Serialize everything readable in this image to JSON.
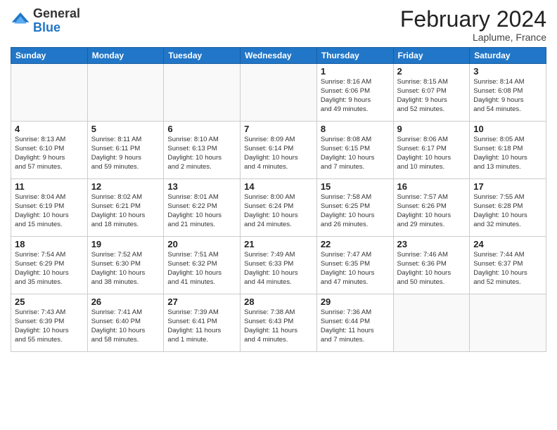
{
  "header": {
    "logo_general": "General",
    "logo_blue": "Blue",
    "month_title": "February 2024",
    "location": "Laplume, France"
  },
  "days_of_week": [
    "Sunday",
    "Monday",
    "Tuesday",
    "Wednesday",
    "Thursday",
    "Friday",
    "Saturday"
  ],
  "weeks": [
    [
      {
        "num": "",
        "info": ""
      },
      {
        "num": "",
        "info": ""
      },
      {
        "num": "",
        "info": ""
      },
      {
        "num": "",
        "info": ""
      },
      {
        "num": "1",
        "info": "Sunrise: 8:16 AM\nSunset: 6:06 PM\nDaylight: 9 hours\nand 49 minutes."
      },
      {
        "num": "2",
        "info": "Sunrise: 8:15 AM\nSunset: 6:07 PM\nDaylight: 9 hours\nand 52 minutes."
      },
      {
        "num": "3",
        "info": "Sunrise: 8:14 AM\nSunset: 6:08 PM\nDaylight: 9 hours\nand 54 minutes."
      }
    ],
    [
      {
        "num": "4",
        "info": "Sunrise: 8:13 AM\nSunset: 6:10 PM\nDaylight: 9 hours\nand 57 minutes."
      },
      {
        "num": "5",
        "info": "Sunrise: 8:11 AM\nSunset: 6:11 PM\nDaylight: 9 hours\nand 59 minutes."
      },
      {
        "num": "6",
        "info": "Sunrise: 8:10 AM\nSunset: 6:13 PM\nDaylight: 10 hours\nand 2 minutes."
      },
      {
        "num": "7",
        "info": "Sunrise: 8:09 AM\nSunset: 6:14 PM\nDaylight: 10 hours\nand 4 minutes."
      },
      {
        "num": "8",
        "info": "Sunrise: 8:08 AM\nSunset: 6:15 PM\nDaylight: 10 hours\nand 7 minutes."
      },
      {
        "num": "9",
        "info": "Sunrise: 8:06 AM\nSunset: 6:17 PM\nDaylight: 10 hours\nand 10 minutes."
      },
      {
        "num": "10",
        "info": "Sunrise: 8:05 AM\nSunset: 6:18 PM\nDaylight: 10 hours\nand 13 minutes."
      }
    ],
    [
      {
        "num": "11",
        "info": "Sunrise: 8:04 AM\nSunset: 6:19 PM\nDaylight: 10 hours\nand 15 minutes."
      },
      {
        "num": "12",
        "info": "Sunrise: 8:02 AM\nSunset: 6:21 PM\nDaylight: 10 hours\nand 18 minutes."
      },
      {
        "num": "13",
        "info": "Sunrise: 8:01 AM\nSunset: 6:22 PM\nDaylight: 10 hours\nand 21 minutes."
      },
      {
        "num": "14",
        "info": "Sunrise: 8:00 AM\nSunset: 6:24 PM\nDaylight: 10 hours\nand 24 minutes."
      },
      {
        "num": "15",
        "info": "Sunrise: 7:58 AM\nSunset: 6:25 PM\nDaylight: 10 hours\nand 26 minutes."
      },
      {
        "num": "16",
        "info": "Sunrise: 7:57 AM\nSunset: 6:26 PM\nDaylight: 10 hours\nand 29 minutes."
      },
      {
        "num": "17",
        "info": "Sunrise: 7:55 AM\nSunset: 6:28 PM\nDaylight: 10 hours\nand 32 minutes."
      }
    ],
    [
      {
        "num": "18",
        "info": "Sunrise: 7:54 AM\nSunset: 6:29 PM\nDaylight: 10 hours\nand 35 minutes."
      },
      {
        "num": "19",
        "info": "Sunrise: 7:52 AM\nSunset: 6:30 PM\nDaylight: 10 hours\nand 38 minutes."
      },
      {
        "num": "20",
        "info": "Sunrise: 7:51 AM\nSunset: 6:32 PM\nDaylight: 10 hours\nand 41 minutes."
      },
      {
        "num": "21",
        "info": "Sunrise: 7:49 AM\nSunset: 6:33 PM\nDaylight: 10 hours\nand 44 minutes."
      },
      {
        "num": "22",
        "info": "Sunrise: 7:47 AM\nSunset: 6:35 PM\nDaylight: 10 hours\nand 47 minutes."
      },
      {
        "num": "23",
        "info": "Sunrise: 7:46 AM\nSunset: 6:36 PM\nDaylight: 10 hours\nand 50 minutes."
      },
      {
        "num": "24",
        "info": "Sunrise: 7:44 AM\nSunset: 6:37 PM\nDaylight: 10 hours\nand 52 minutes."
      }
    ],
    [
      {
        "num": "25",
        "info": "Sunrise: 7:43 AM\nSunset: 6:39 PM\nDaylight: 10 hours\nand 55 minutes."
      },
      {
        "num": "26",
        "info": "Sunrise: 7:41 AM\nSunset: 6:40 PM\nDaylight: 10 hours\nand 58 minutes."
      },
      {
        "num": "27",
        "info": "Sunrise: 7:39 AM\nSunset: 6:41 PM\nDaylight: 11 hours\nand 1 minute."
      },
      {
        "num": "28",
        "info": "Sunrise: 7:38 AM\nSunset: 6:43 PM\nDaylight: 11 hours\nand 4 minutes."
      },
      {
        "num": "29",
        "info": "Sunrise: 7:36 AM\nSunset: 6:44 PM\nDaylight: 11 hours\nand 7 minutes."
      },
      {
        "num": "",
        "info": ""
      },
      {
        "num": "",
        "info": ""
      }
    ]
  ]
}
